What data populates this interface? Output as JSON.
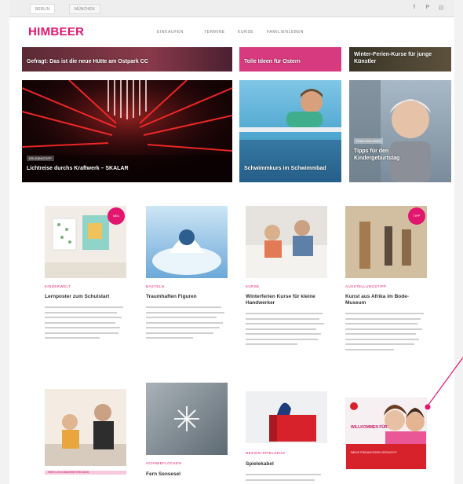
{
  "brand": {
    "logo": "HIMBEER",
    "accent": "#e2156f"
  },
  "topbar": {
    "tabs": [
      "BERLIN",
      "MÜNCHEN"
    ],
    "social": [
      "f",
      "P",
      "⊡"
    ]
  },
  "nav": [
    "EINKAUFEN",
    "TERMINE",
    "KURSE",
    "FAMILIENLEBEN"
  ],
  "hero": {
    "top_captions": [
      "Gefragt: Das ist die neue Hütte am Ostpark CC",
      "Tolle Ideen für Ostern",
      "Winter-Ferien-Kurse für junge Künstler"
    ],
    "big_tag": "ERLEBNISTIPP",
    "big_caption": "Lichtreise durchs Kraftwerk – SKALAR",
    "mid_caption": "Schwimmkurs im Schwimmbad",
    "right_tag": "FAMILIENLEBEN",
    "right_caption": "Tipps für den Kindergeburtstag"
  },
  "cards_row1": [
    {
      "kicker": "KINDERWELT",
      "title": "Lernposter zum Schulstart"
    },
    {
      "kicker": "BASTELN",
      "title": "Traumhaften Figuren"
    },
    {
      "kicker": "KURSE",
      "title": "Winterferien Kurse für kleine Handwerker"
    },
    {
      "kicker": "AUSSTELLUNGSTIPP",
      "title": "Kunst aus Afrika im Bode-Museum"
    }
  ],
  "badges": [
    "NEU",
    "TIPP"
  ],
  "cards_row2": [
    {
      "kicker": "KINDERWELT",
      "pinkbar": "HIER LOS KINDERBETREUUNG"
    },
    {
      "kicker": "SCHNEEFLOCKEN",
      "title": "Fern Sensesel"
    },
    {
      "kicker": "DESIGN-SPIELZEUG",
      "title": "Spielekabel"
    },
    {
      "kicker": "",
      "ad_text": "WILLKOMMEN FÜR",
      "ad_small": "NEUE PÄDAGOGEN GESUCHT"
    }
  ]
}
